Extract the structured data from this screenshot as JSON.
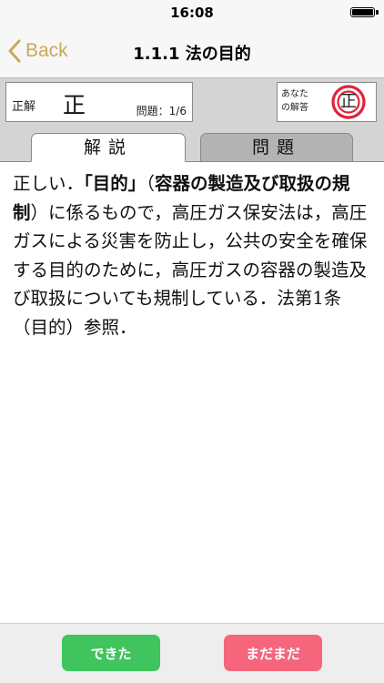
{
  "status_bar": {
    "time": "16:08"
  },
  "nav": {
    "back_label": "Back",
    "title": "1.1.1 法の目的"
  },
  "info": {
    "correct_label": "正解",
    "correct_value": "正",
    "counter": "問題：1/6",
    "your_answer_label_line1": "あなた",
    "your_answer_label_line2": "の解答",
    "your_answer_value": "正"
  },
  "tabs": [
    {
      "label": "解説"
    },
    {
      "label": "問題"
    }
  ],
  "content": {
    "p1": "正しい．",
    "q1": "「目的」",
    "p2": "（",
    "b2": "容器の製造及び取扱の規制",
    "p3": "）に係るもので，高圧ガス保安法は，高圧ガスによる災害を防止し，公共の安全を確保する目的のために，高圧ガスの容器の製造及び取扱についても規制している．法第1条（目的）参照．"
  },
  "buttons": {
    "done": "できた",
    "not_yet": "まだまだ"
  },
  "colors": {
    "accent": "#c9a95a",
    "seal_red": "#e0233a",
    "done_green": "#3fc45e",
    "notyet_pink": "#f5667c"
  }
}
